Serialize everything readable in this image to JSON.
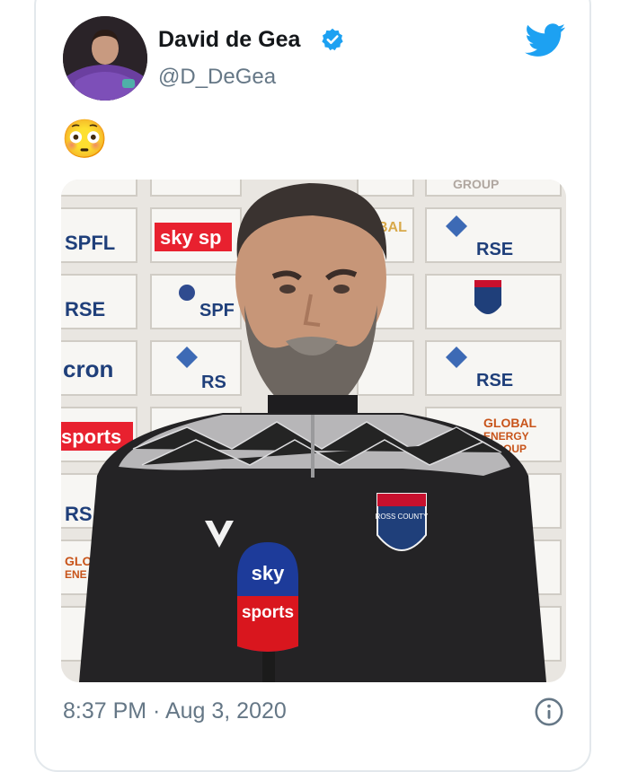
{
  "tweet": {
    "display_name": "David de Gea",
    "handle": "@D_DeGea",
    "body_emoji": "😳",
    "timestamp": "8:37 PM · Aug 3, 2020",
    "verified": true
  },
  "media": {
    "board_texts": [
      "SPFL",
      "sky sp",
      "BAL",
      "RSE",
      "SPF",
      "cron",
      "RS",
      "RSE",
      "sports",
      "GLOBAL",
      "ENERGY",
      "GROUP",
      "RS",
      "GROUP",
      "RSE"
    ],
    "mic_top": "sky",
    "mic_bottom": "sports",
    "crest_text": "ROSS COUNTY"
  },
  "icons": {
    "verified": "verified-badge-icon",
    "brand": "twitter-bird-icon",
    "info": "info-icon"
  },
  "colors": {
    "twitter_blue": "#1da1f2",
    "text_primary": "#14171a",
    "text_secondary": "#657786",
    "card_border": "#e3e8ec"
  }
}
